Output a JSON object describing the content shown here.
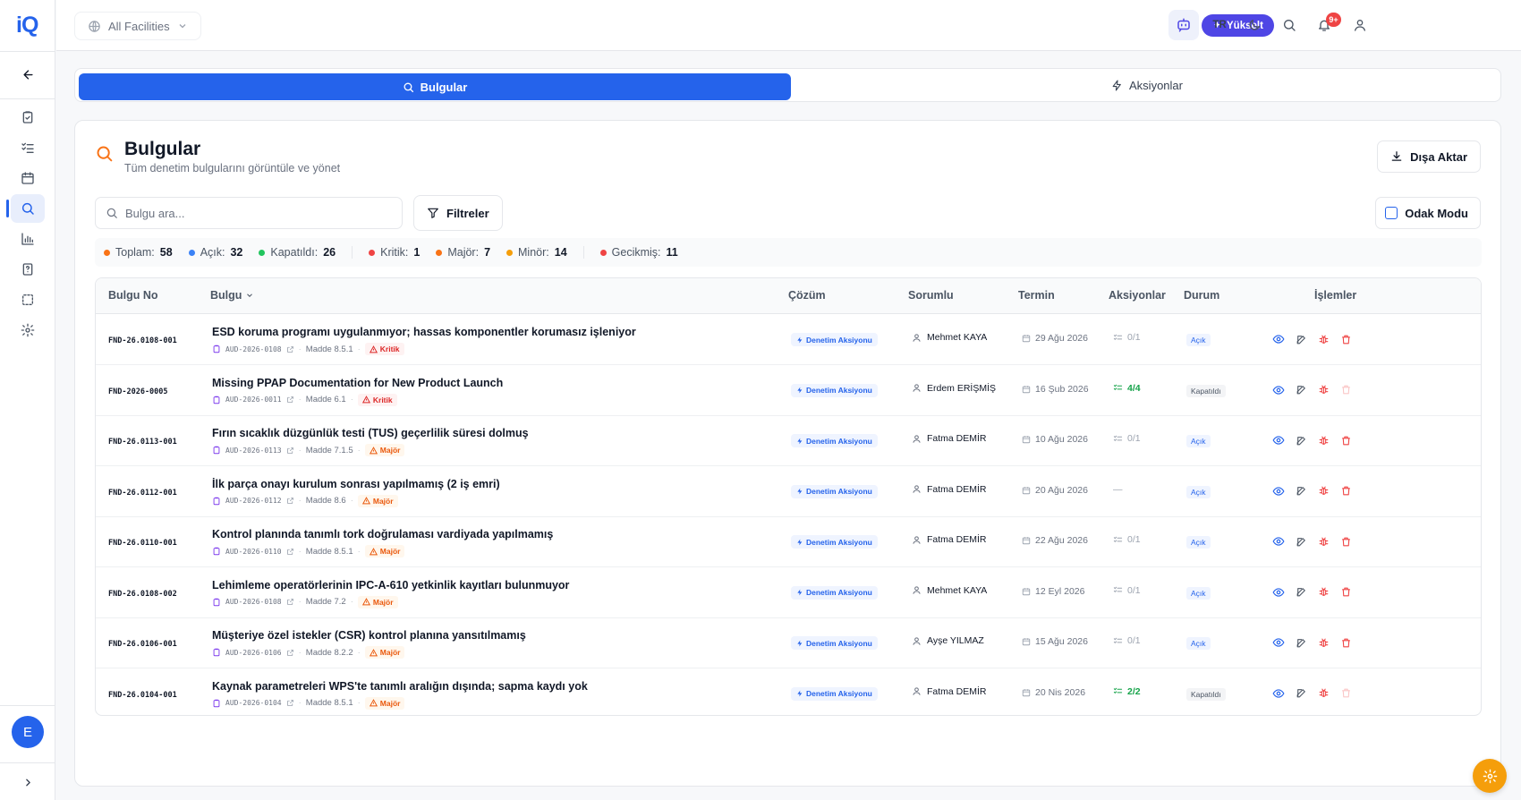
{
  "app": {
    "logo": "iQ"
  },
  "topbar": {
    "facility_label": "All Facilities",
    "upgrade_label": "Yükselt",
    "language": "TR",
    "notification_count": "9+"
  },
  "sidebar": {
    "items": [
      {
        "name": "audits",
        "icon": "clipboard-check-icon",
        "active": false
      },
      {
        "name": "checklists",
        "icon": "list-checks-icon",
        "active": false
      },
      {
        "name": "calendar",
        "icon": "calendar-icon",
        "active": false
      },
      {
        "name": "findings",
        "icon": "search-icon",
        "active": true
      },
      {
        "name": "reports",
        "icon": "bar-chart-icon",
        "active": false
      },
      {
        "name": "questions",
        "icon": "help-document-icon",
        "active": false
      },
      {
        "name": "scan",
        "icon": "scan-icon",
        "active": false
      },
      {
        "name": "settings",
        "icon": "gear-icon",
        "active": false
      }
    ],
    "avatar_initial": "E"
  },
  "tabs": [
    {
      "label": "Bulgular",
      "icon": "search-icon",
      "active": true
    },
    {
      "label": "Aksiyonlar",
      "icon": "lightning-icon",
      "active": false
    }
  ],
  "page": {
    "title": "Bulgular",
    "subtitle": "Tüm denetim bulgularını görüntüle ve yönet",
    "export_label": "Dışa Aktar",
    "search_placeholder": "Bulgu ara...",
    "filter_label": "Filtreler",
    "focus_label": "Odak Modu"
  },
  "stats": [
    {
      "label": "Toplam:",
      "value": "58",
      "color": "#f97316"
    },
    {
      "label": "Açık:",
      "value": "32",
      "color": "#3b82f6"
    },
    {
      "label": "Kapatıldı:",
      "value": "26",
      "color": "#22c55e"
    },
    {
      "label": "Kritik:",
      "value": "1",
      "color": "#ef4444"
    },
    {
      "label": "Majör:",
      "value": "7",
      "color": "#f97316"
    },
    {
      "label": "Minör:",
      "value": "14",
      "color": "#f59e0b"
    },
    {
      "label": "Gecikmiş:",
      "value": "11",
      "color": "#ef4444"
    }
  ],
  "table": {
    "headers": {
      "no": "Bulgu No",
      "finding": "Bulgu",
      "solution": "Çözüm",
      "responsible": "Sorumlu",
      "due": "Termin",
      "actions": "Aksiyonlar",
      "status": "Durum",
      "operations": "İşlemler"
    },
    "rows": [
      {
        "no": "FND-26.0108-001",
        "title": "ESD koruma programı uygulanmıyor; hassas komponentler korumasız işleniyor",
        "audit": "AUD-2026-0108",
        "clause": "Madde 8.5.1",
        "severity": "Kritik",
        "severity_color": "red",
        "solution": "Denetim Aksiyonu",
        "responsible": "Mehmet KAYA",
        "due": "29 Ağu 2026",
        "actions": "0/1",
        "actions_done": false,
        "status": "Açık",
        "status_kind": "open",
        "delete_enabled": true
      },
      {
        "no": "FND-2026-0005",
        "title": "Missing PPAP Documentation for New Product Launch",
        "audit": "AUD-2026-0011",
        "clause": "Madde 6.1",
        "severity": "Kritik",
        "severity_color": "red",
        "solution": "Denetim Aksiyonu",
        "responsible": "Erdem ERİŞMİŞ",
        "due": "16 Şub 2026",
        "actions": "4/4",
        "actions_done": true,
        "status": "Kapatıldı",
        "status_kind": "closed",
        "delete_enabled": false
      },
      {
        "no": "FND-26.0113-001",
        "title": "Fırın sıcaklık düzgünlük testi (TUS) geçerlilik süresi dolmuş",
        "audit": "AUD-2026-0113",
        "clause": "Madde 7.1.5",
        "severity": "Majör",
        "severity_color": "orange",
        "solution": "Denetim Aksiyonu",
        "responsible": "Fatma DEMİR",
        "due": "10 Ağu 2026",
        "actions": "0/1",
        "actions_done": false,
        "status": "Açık",
        "status_kind": "open",
        "delete_enabled": true
      },
      {
        "no": "FND-26.0112-001",
        "title": "İlk parça onayı kurulum sonrası yapılmamış (2 iş emri)",
        "audit": "AUD-2026-0112",
        "clause": "Madde 8.6",
        "severity": "Majör",
        "severity_color": "orange",
        "solution": "Denetim Aksiyonu",
        "responsible": "Fatma DEMİR",
        "due": "20 Ağu 2026",
        "actions": "—",
        "actions_done": false,
        "no_actions": true,
        "status": "Açık",
        "status_kind": "open",
        "delete_enabled": true
      },
      {
        "no": "FND-26.0110-001",
        "title": "Kontrol planında tanımlı tork doğrulaması vardiyada yapılmamış",
        "audit": "AUD-2026-0110",
        "clause": "Madde 8.5.1",
        "severity": "Majör",
        "severity_color": "orange",
        "solution": "Denetim Aksiyonu",
        "responsible": "Fatma DEMİR",
        "due": "22 Ağu 2026",
        "actions": "0/1",
        "actions_done": false,
        "status": "Açık",
        "status_kind": "open",
        "delete_enabled": true
      },
      {
        "no": "FND-26.0108-002",
        "title": "Lehimleme operatörlerinin IPC-A-610 yetkinlik kayıtları bulunmuyor",
        "audit": "AUD-2026-0108",
        "clause": "Madde 7.2",
        "severity": "Majör",
        "severity_color": "orange",
        "solution": "Denetim Aksiyonu",
        "responsible": "Mehmet KAYA",
        "due": "12 Eyl 2026",
        "actions": "0/1",
        "actions_done": false,
        "status": "Açık",
        "status_kind": "open",
        "delete_enabled": true
      },
      {
        "no": "FND-26.0106-001",
        "title": "Müşteriye özel istekler (CSR) kontrol planına yansıtılmamış",
        "audit": "AUD-2026-0106",
        "clause": "Madde 8.2.2",
        "severity": "Majör",
        "severity_color": "orange",
        "solution": "Denetim Aksiyonu",
        "responsible": "Ayşe YILMAZ",
        "due": "15 Ağu 2026",
        "actions": "0/1",
        "actions_done": false,
        "status": "Açık",
        "status_kind": "open",
        "delete_enabled": true
      },
      {
        "no": "FND-26.0104-001",
        "title": "Kaynak parametreleri WPS'te tanımlı aralığın dışında; sapma kaydı yok",
        "audit": "AUD-2026-0104",
        "clause": "Madde 8.5.1",
        "severity": "Majör",
        "severity_color": "orange",
        "solution": "Denetim Aksiyonu",
        "responsible": "Fatma DEMİR",
        "due": "20 Nis 2026",
        "actions": "2/2",
        "actions_done": true,
        "status": "Kapatıldı",
        "status_kind": "closed",
        "delete_enabled": false
      }
    ]
  },
  "colors": {
    "accent": "#2563eb",
    "upgrade": "#4f46e5",
    "danger": "#ef4444",
    "fab": "#f59e0b"
  }
}
